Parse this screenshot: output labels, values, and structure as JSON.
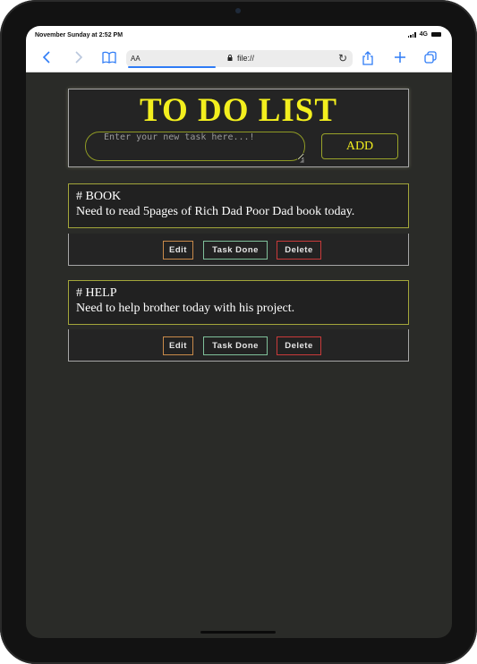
{
  "status_bar": {
    "time": "November Sunday at 2:52 PM",
    "network": "4G"
  },
  "browser": {
    "text_size_label": "AA",
    "url": "file://",
    "accent_color": "#2f7cf6",
    "icons": [
      "back-icon",
      "forward-icon",
      "bookmarks-icon",
      "lock-icon",
      "reload-icon",
      "share-icon",
      "new-tab-icon",
      "tabs-icon"
    ]
  },
  "app": {
    "title": "TO DO LIST",
    "input_placeholder": "Enter your new task here...!",
    "add_label": "ADD",
    "title_color": "#f3ef1e",
    "tasks": [
      {
        "heading": "# BOOK",
        "description": "Need to read 5pages of Rich Dad Poor Dad book today.",
        "edit_label": "Edit",
        "done_label": "Task Done",
        "delete_label": "Delete"
      },
      {
        "heading": "# HELP",
        "description": "Need to help brother today with his project.",
        "edit_label": "Edit",
        "done_label": "Task Done",
        "delete_label": "Delete"
      }
    ]
  }
}
